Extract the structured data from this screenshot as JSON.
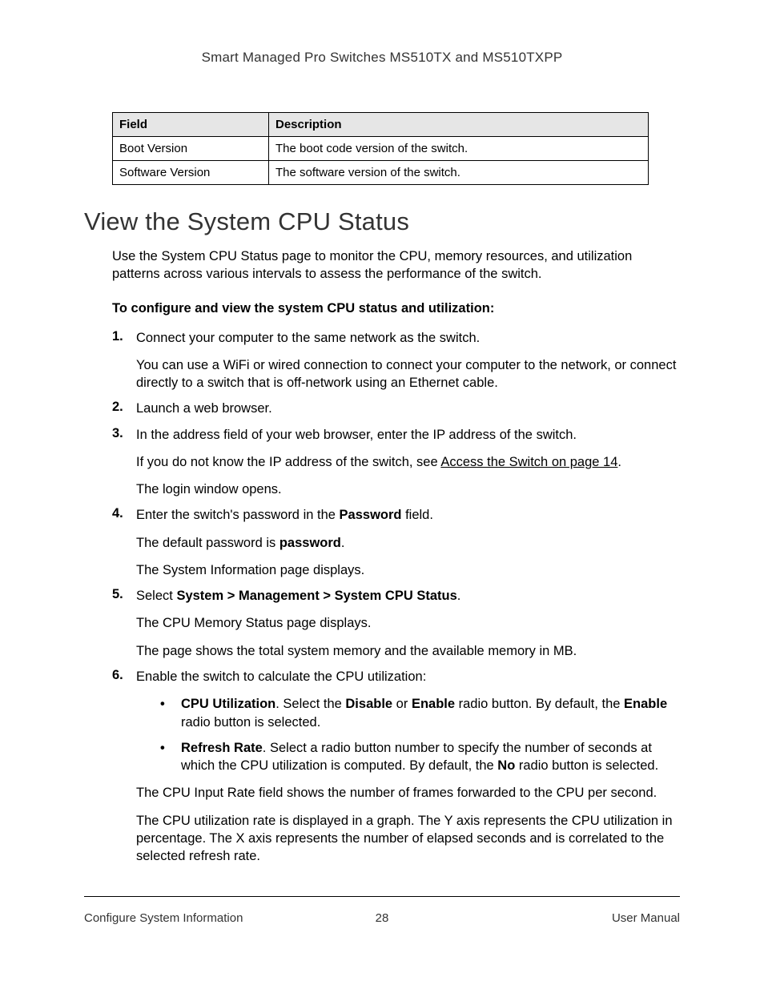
{
  "header": {
    "title": "Smart Managed Pro Switches MS510TX and MS510TXPP"
  },
  "table": {
    "headers": [
      "Field",
      "Description"
    ],
    "rows": [
      [
        "Boot Version",
        "The boot code version of the switch."
      ],
      [
        "Software Version",
        "The software version of the switch."
      ]
    ]
  },
  "section": {
    "heading": "View the System CPU Status",
    "intro": "Use the System CPU Status page to monitor the CPU, memory resources, and utilization patterns across various intervals to assess the performance of the switch.",
    "subheading": "To configure and view the system CPU status and utilization:"
  },
  "steps": {
    "s1": {
      "num": "1.",
      "p1": "Connect your computer to the same network as the switch.",
      "p2": "You can use a WiFi or wired connection to connect your computer to the network, or connect directly to a switch that is off-network using an Ethernet cable."
    },
    "s2": {
      "num": "2.",
      "p1": "Launch a web browser."
    },
    "s3": {
      "num": "3.",
      "p1": "In the address field of your web browser, enter the IP address of the switch.",
      "p2a": "If you do not know the IP address of the switch, see ",
      "p2link": "Access the Switch on page 14",
      "p2b": ".",
      "p3": "The login window opens."
    },
    "s4": {
      "num": "4.",
      "p1a": "Enter the switch's password in the ",
      "p1bold": "Password",
      "p1b": " field.",
      "p2a": "The default password is ",
      "p2bold": "password",
      "p2b": ".",
      "p3": "The System Information page displays."
    },
    "s5": {
      "num": "5.",
      "p1a": "Select ",
      "p1bold": "System > Management > System CPU Status",
      "p1b": ".",
      "p2": "The CPU Memory Status page displays.",
      "p3": "The page shows the total system memory and the available memory in MB."
    },
    "s6": {
      "num": "6.",
      "p1": "Enable the switch to calculate the CPU utilization:",
      "b1": {
        "bold1": "CPU Utilization",
        "t1": ". Select the ",
        "bold2": "Disable",
        "t2": " or ",
        "bold3": "Enable",
        "t3": " radio button. By default, the ",
        "bold4": "Enable",
        "t4": " radio button is selected."
      },
      "b2": {
        "bold1": "Refresh Rate",
        "t1": ". Select a radio button number to specify the number of seconds at which the CPU utilization is computed. By default, the ",
        "bold2": "No",
        "t2": " radio button is selected."
      },
      "p2": "The CPU Input Rate field shows the number of frames forwarded to the CPU per second.",
      "p3": "The CPU utilization rate is displayed in a graph. The Y axis represents the CPU utilization in percentage. The X axis represents the number of elapsed seconds and is correlated to the selected refresh rate."
    }
  },
  "footer": {
    "left": "Configure System Information",
    "center": "28",
    "right": "User Manual"
  }
}
